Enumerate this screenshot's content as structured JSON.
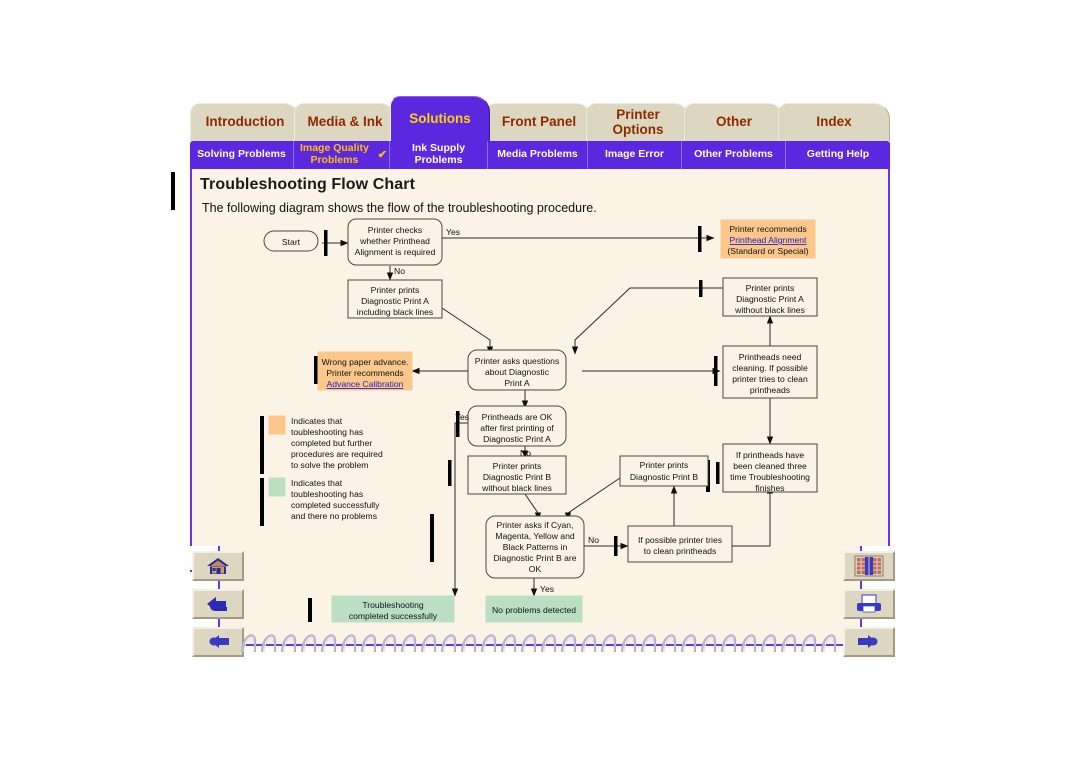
{
  "window": {
    "title": "Troubleshooting Flow Chart"
  },
  "primary_tabs": [
    {
      "label": "Introduction",
      "active": false
    },
    {
      "label": "Media & Ink",
      "active": false
    },
    {
      "label": "Solutions",
      "active": true
    },
    {
      "label": "Front Panel",
      "active": false
    },
    {
      "label": "Printer Options",
      "active": false
    },
    {
      "label": "Other",
      "active": false
    },
    {
      "label": "Index",
      "active": false
    }
  ],
  "sub_tabs": [
    {
      "label": "Solving Problems",
      "state": "normal"
    },
    {
      "label": "Image Quality Problems",
      "state": "visited",
      "check": "✔"
    },
    {
      "label": "Ink Supply Problems",
      "state": "current"
    },
    {
      "label": "Media Problems",
      "state": "normal"
    },
    {
      "label": "Image Error",
      "state": "normal"
    },
    {
      "label": "Other Problems",
      "state": "normal"
    },
    {
      "label": "Getting Help",
      "state": "normal"
    }
  ],
  "content": {
    "heading": "Troubleshooting Flow Chart",
    "intro": "The following diagram shows the flow of the troubleshooting procedure."
  },
  "colors": {
    "accent_purple": "#5B28E0",
    "tab_tan": "#ddd6c0",
    "page_cream": "#FBF3E5",
    "orange_box": "#FBC78A",
    "green_box": "#BCDFC4",
    "tab_text": "#8c2b00",
    "active_tab_text": "#FFD200",
    "link_blue": "#2222CC"
  },
  "flowchart": {
    "nodes": [
      {
        "id": "start",
        "label": "Start",
        "shape": "rounded",
        "fill": "#FBF3E5"
      },
      {
        "id": "check_align",
        "label": "Printer checks\nwhether Printhead\nAlignment is required",
        "shape": "rounded",
        "fill": "#FBF3E5"
      },
      {
        "id": "recommend_align",
        "label": "Printer recommends\nPrinthead Alignment\n(Standard or Special)",
        "shape": "rect",
        "fill": "#FBC78A",
        "link_line": "Printhead Alignment"
      },
      {
        "id": "print_a_black",
        "label": "Printer prints\nDiagnostic Print A\nincluding black lines",
        "shape": "rect",
        "fill": "#FBF3E5"
      },
      {
        "id": "print_a_noblack",
        "label": "Printer prints\nDiagnostic Print A\nwithout black lines",
        "shape": "rect",
        "fill": "#FBF3E5"
      },
      {
        "id": "wrong_advance",
        "label": "Wrong paper advance.\nPrinter recommends\nAdvance Calibration",
        "shape": "rect",
        "fill": "#FBC78A",
        "link_line": "Advance Calibration"
      },
      {
        "id": "ask_print_a",
        "label": "Printer asks questions\nabout Diagnostic\nPrint A",
        "shape": "rounded",
        "fill": "#FBF3E5"
      },
      {
        "id": "need_clean",
        "label": "Printheads need\ncleaning. If possible\nprinter tries to clean\nprintheads",
        "shape": "rect",
        "fill": "#FBF3E5"
      },
      {
        "id": "heads_ok",
        "label": "Printheads are OK\nafter first printing of\nDiagnostic Print A",
        "shape": "rounded",
        "fill": "#FBF3E5"
      },
      {
        "id": "print_b_noblack",
        "label": "Printer prints\nDiagnostic Print B\nwithout black lines",
        "shape": "rect",
        "fill": "#FBF3E5"
      },
      {
        "id": "print_b",
        "label": "Printer prints\nDiagnostic Print B",
        "shape": "rect",
        "fill": "#FBF3E5"
      },
      {
        "id": "cleaned_three",
        "label": "If printheads have\nbeen cleaned three\ntime Troubleshooting\nfinishes",
        "shape": "rect",
        "fill": "#FBF3E5"
      },
      {
        "id": "ask_patterns",
        "label": "Printer asks if Cyan,\nMagenta, Yellow and\nBlack Patterns in\nDiagnostic Print B are\nOK",
        "shape": "rounded",
        "fill": "#FBF3E5"
      },
      {
        "id": "try_clean",
        "label": "If possible printer tries\nto clean printheads",
        "shape": "rect",
        "fill": "#FBF3E5"
      },
      {
        "id": "ts_success",
        "label": "Troubleshooting\ncompleted successfully",
        "shape": "rect",
        "fill": "#BCDFC4"
      },
      {
        "id": "no_problems",
        "label": "No problems detected",
        "shape": "rect",
        "fill": "#BCDFC4"
      }
    ],
    "edge_labels": [
      {
        "text": "Yes",
        "for": "check_align -> recommend_align"
      },
      {
        "text": "No",
        "for": "check_align -> print_a_black"
      },
      {
        "text": "Yes",
        "for": "heads_ok -> ts_success"
      },
      {
        "text": "No",
        "for": "heads_ok -> print_b_noblack"
      },
      {
        "text": "No",
        "for": "ask_patterns -> try_clean"
      },
      {
        "text": "Yes",
        "for": "ask_patterns -> no_problems"
      }
    ],
    "legend": [
      {
        "swatch": "#FBC78A",
        "text": "Indicates that toubleshooting has completed but further procedures are required to solve the problem"
      },
      {
        "swatch": "#BCDFC4",
        "text": "Indicates that toubleshooting has completed successfully and there no problems"
      }
    ]
  },
  "nav_left": [
    {
      "name": "home-button",
      "icon": "house-icon"
    },
    {
      "name": "back-button",
      "icon": "back-arrow-icon"
    },
    {
      "name": "previous-page-button",
      "icon": "hand-left-icon"
    }
  ],
  "nav_right": [
    {
      "name": "bookshelf-button",
      "icon": "bookshelf-icon"
    },
    {
      "name": "print-button",
      "icon": "printer-icon"
    },
    {
      "name": "next-page-button",
      "icon": "hand-right-icon"
    }
  ]
}
